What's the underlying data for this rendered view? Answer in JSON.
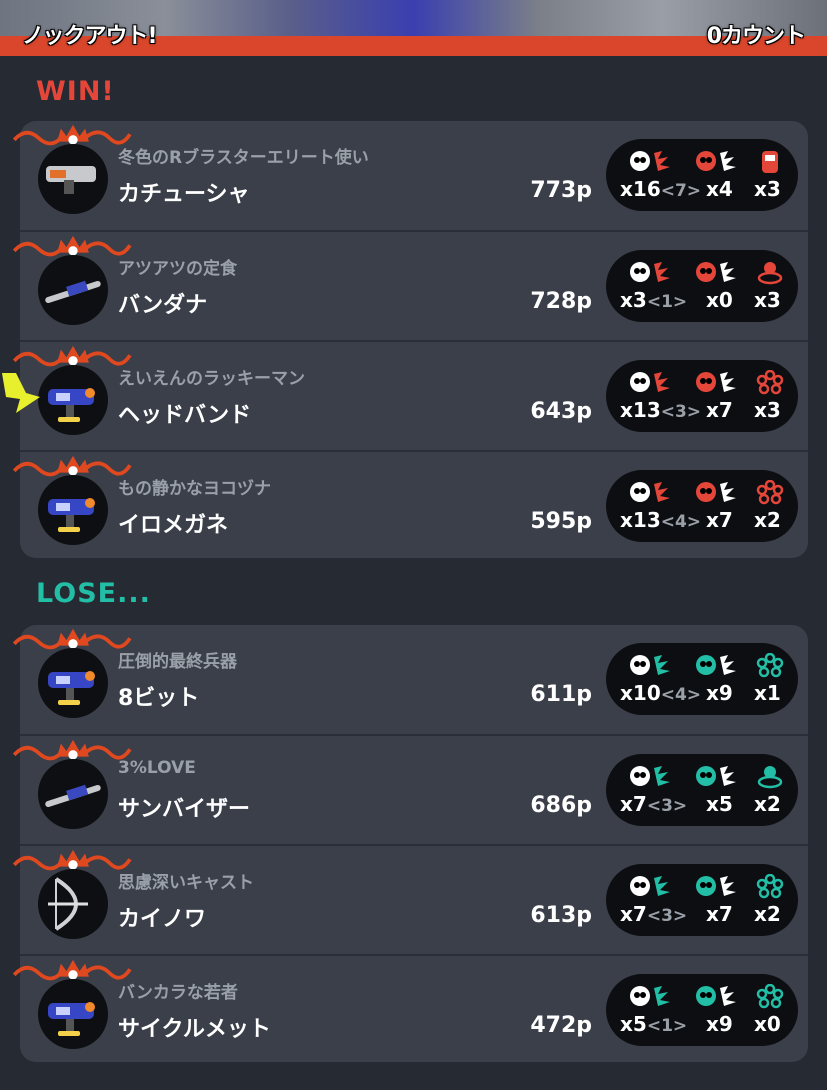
{
  "header": {
    "result_text": "ノックアウト!",
    "count_text": "0カウント"
  },
  "win_label": "WIN!",
  "lose_label": "LOSE...",
  "colors": {
    "win": "#e5463a",
    "lose": "#22bfa6",
    "orange": "#d9462b"
  },
  "win_players": [
    {
      "title": "冬色のRブラスターエリート使い",
      "name": "カチューシャ",
      "points": "773p",
      "kills": "x16",
      "assists": "<7>",
      "deaths": "x4",
      "specials": "x3",
      "weapon_icon": "blaster-icon",
      "special_icon": "ink-armor-icon"
    },
    {
      "title": "アツアツの定食",
      "name": "バンダナ",
      "points": "728p",
      "kills": "x3",
      "assists": "<1>",
      "deaths": "x0",
      "specials": "x3",
      "weapon_icon": "charger-icon",
      "special_icon": "sting-ray-icon"
    },
    {
      "title": "えいえんのラッキーマン",
      "name": "ヘッドバンド",
      "points": "643p",
      "kills": "x13",
      "assists": "<3>",
      "deaths": "x7",
      "specials": "x3",
      "weapon_icon": "shooter-icon",
      "special_icon": "bubble-blower-icon"
    },
    {
      "title": "もの静かなヨコヅナ",
      "name": "イロメガネ",
      "points": "595p",
      "kills": "x13",
      "assists": "<4>",
      "deaths": "x7",
      "specials": "x2",
      "weapon_icon": "shooter-icon",
      "special_icon": "bubble-blower-icon"
    }
  ],
  "lose_players": [
    {
      "title": "圧倒的最終兵器",
      "name": "8ビット",
      "points": "611p",
      "kills": "x10",
      "assists": "<4>",
      "deaths": "x9",
      "specials": "x1",
      "weapon_icon": "shooter-icon",
      "special_icon": "bubble-blower-icon"
    },
    {
      "title": "3%LOVE",
      "name": "サンバイザー",
      "points": "686p",
      "kills": "x7",
      "assists": "<3>",
      "deaths": "x5",
      "specials": "x2",
      "weapon_icon": "charger-icon",
      "special_icon": "sting-ray-icon"
    },
    {
      "title": "思慮深いキャスト",
      "name": "カイノワ",
      "points": "613p",
      "kills": "x7",
      "assists": "<3>",
      "deaths": "x7",
      "specials": "x2",
      "weapon_icon": "bow-icon",
      "special_icon": "bubble-blower-icon"
    },
    {
      "title": "バンカラな若者",
      "name": "サイクルメット",
      "points": "472p",
      "kills": "x5",
      "assists": "<1>",
      "deaths": "x9",
      "specials": "x0",
      "weapon_icon": "shooter-icon",
      "special_icon": "bubble-blower-icon"
    }
  ]
}
